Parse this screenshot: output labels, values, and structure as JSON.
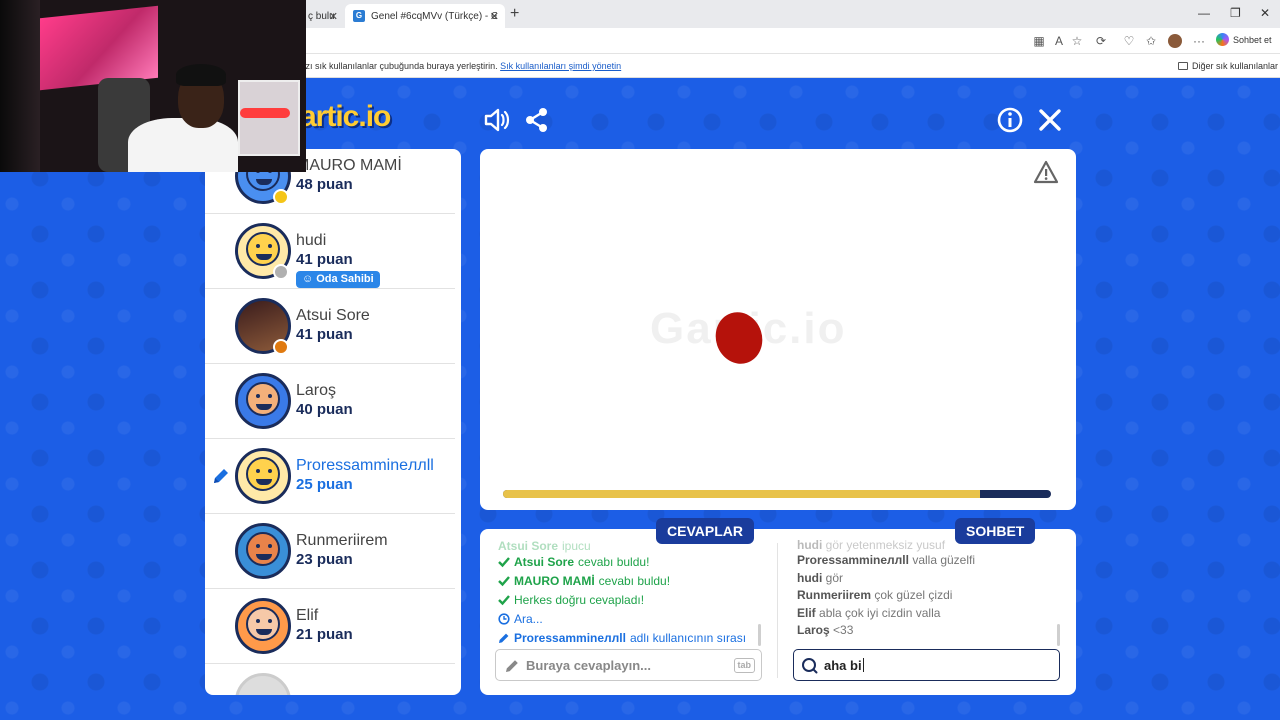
{
  "browser": {
    "inactive_tab_title": "ç bulu",
    "active_tab_title": "Genel #6cqMVv (Türkçe) - Gartic.io",
    "active_tab_favicon": "G",
    "tab_close": "✕",
    "new_tab": "+",
    "chat_button_label": "Sohbet et",
    "favorites_hint": "ızı sık kullanılanlar çubuğunda buraya yerleştirin.",
    "favorites_hint_link": "Sık kullanılanları şimdi yönetin",
    "other_favorites": "Diğer sık kullanılanlar",
    "window_controls": [
      "—",
      "❐",
      "✕"
    ],
    "menu_dots": "···"
  },
  "game": {
    "logo": "artic.io",
    "canvas_watermark": "Gartic.io",
    "progress_fraction": 0.87,
    "colors": {
      "background": "#1c5ee6",
      "navy": "#1a2c5b",
      "accent_blue": "#1a6fe0",
      "correct_green": "#1fa34a",
      "progress_fill": "#e8c24a",
      "drawing_blob": "#b5120b"
    }
  },
  "players": [
    {
      "name": "MAURO MAMİ",
      "score": "48 puan",
      "status_color": "#f5c518",
      "avatar": "blue-hair-bearded-avatar"
    },
    {
      "name": "hudi",
      "score": "41 puan",
      "status_color": "#b0b0b0",
      "badge": "Oda Sahibi",
      "avatar": "yellow-smile-avatar"
    },
    {
      "name": "Atsui Sore",
      "score": "41 puan",
      "status_color": "#e07a10",
      "avatar": "photo-avatar"
    },
    {
      "name": "Laroş",
      "score": "40 puan",
      "avatar": "glasses-bearded-avatar"
    },
    {
      "name": "Proressammineллll",
      "score": "25 puan",
      "drawing": true,
      "avatar": "yellow-smile-avatar"
    },
    {
      "name": "Runmeriirem",
      "score": "23 puan",
      "avatar": "blue-hair-girl-avatar"
    },
    {
      "name": "Elif",
      "score": "21 puan",
      "avatar": "orange-hair-girl-avatar"
    }
  ],
  "answers": {
    "tab_label": "CEVAPLAR",
    "lines": [
      {
        "name": "Atsui Sore",
        "text": "ipucu"
      },
      {
        "name": "Atsui Sore",
        "text": "cevabı buldu!"
      },
      {
        "name": "MAURO MAMİ",
        "text": "cevabı buldu!"
      },
      {
        "name": "",
        "text": "Herkes doğru cevapladı!"
      },
      {
        "name": "",
        "text": "Ara..."
      },
      {
        "name": "Proressammineллll",
        "text": "adlı kullanıcının sırası"
      }
    ],
    "input_placeholder": "Buraya cevaplayın...",
    "tab_key_hint": "tab"
  },
  "chat": {
    "tab_label": "SOHBET",
    "lines": [
      {
        "name": "hudi",
        "text": "gör yetenmeksiz yusuf"
      },
      {
        "name": "Proressammineллll",
        "text": "valla güzelfi"
      },
      {
        "name": "hudi",
        "text": "gör"
      },
      {
        "name": "Runmeriirem",
        "text": "çok güzel çizdi"
      },
      {
        "name": "Elif",
        "text": "abla çok iyi cizdin valla"
      },
      {
        "name": "Laroş",
        "text": "<33"
      }
    ],
    "input_value": "aha bi"
  }
}
